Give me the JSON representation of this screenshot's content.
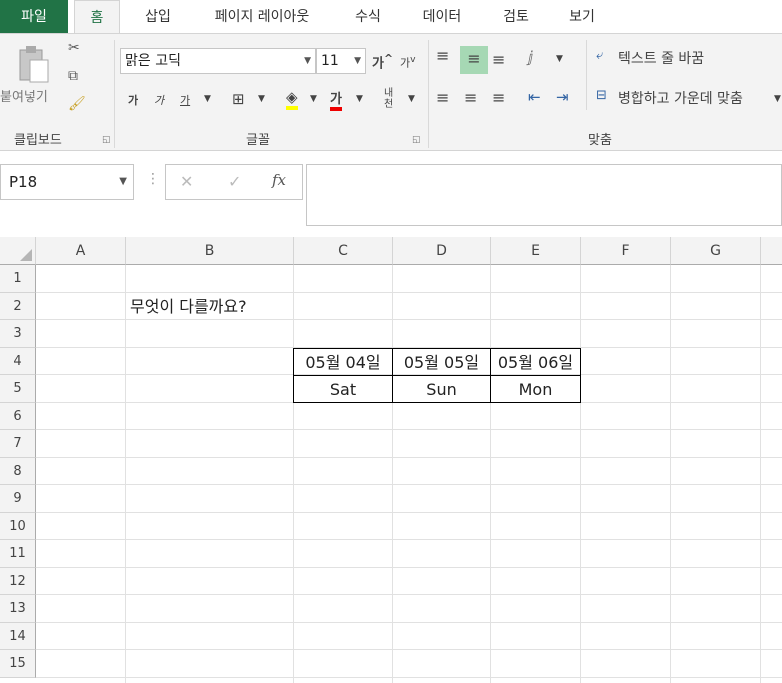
{
  "ribbon_tabs": [
    "파일",
    "홈",
    "삽입",
    "페이지 레이아웃",
    "수식",
    "데이터",
    "검토",
    "보기"
  ],
  "clipboard": {
    "paste_label": "붙여넣기",
    "group_label": "클립보드"
  },
  "font": {
    "name": "맑은 고딕",
    "size": "11",
    "group_label": "글꼴",
    "grow_label": "가",
    "shrink_label": "가",
    "bold_label": "가",
    "italic_label": "가",
    "underline_label": "가",
    "color_label": "가",
    "phonetic_label": "내천"
  },
  "alignment": {
    "wrap_label": "텍스트 줄 바꿈",
    "merge_label": "병합하고 가운데 맞춤",
    "group_label": "맞춤"
  },
  "formula_bar": {
    "name_box": "P18",
    "fx_label": "fx",
    "formula": ""
  },
  "sheet": {
    "columns": [
      "A",
      "B",
      "C",
      "D",
      "E",
      "F",
      "G"
    ],
    "rows": [
      "1",
      "2",
      "3",
      "4",
      "5",
      "6",
      "7",
      "8",
      "9",
      "10",
      "11",
      "12",
      "13",
      "14",
      "15"
    ],
    "b2": "무엇이 다를까요?",
    "c4": "05월 04일",
    "d4": "05월 05일",
    "e4": "05월 06일",
    "c5": "Sat",
    "d5": "Sun",
    "e5": "Mon"
  }
}
